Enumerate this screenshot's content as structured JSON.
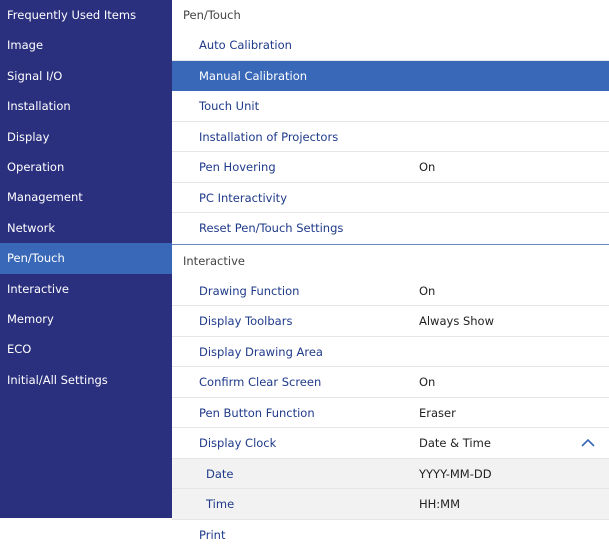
{
  "sidebar": {
    "items": [
      {
        "label": "Frequently Used Items"
      },
      {
        "label": "Image"
      },
      {
        "label": "Signal I/O"
      },
      {
        "label": "Installation"
      },
      {
        "label": "Display"
      },
      {
        "label": "Operation"
      },
      {
        "label": "Management"
      },
      {
        "label": "Network"
      },
      {
        "label": "Pen/Touch"
      },
      {
        "label": "Interactive"
      },
      {
        "label": "Memory"
      },
      {
        "label": "ECO"
      },
      {
        "label": "Initial/All Settings"
      }
    ],
    "active_index": 8
  },
  "pen_touch": {
    "header": "Pen/Touch",
    "rows": [
      {
        "label": "Auto Calibration",
        "value": ""
      },
      {
        "label": "Manual Calibration",
        "value": ""
      },
      {
        "label": "Touch Unit",
        "value": ""
      },
      {
        "label": "Installation of Projectors",
        "value": ""
      },
      {
        "label": "Pen Hovering",
        "value": "On"
      },
      {
        "label": "PC Interactivity",
        "value": ""
      },
      {
        "label": "Reset Pen/Touch Settings",
        "value": ""
      }
    ],
    "selected_index": 1
  },
  "interactive": {
    "header": "Interactive",
    "rows": [
      {
        "label": "Drawing Function",
        "value": "On"
      },
      {
        "label": "Display Toolbars",
        "value": "Always Show"
      },
      {
        "label": "Display Drawing Area",
        "value": ""
      },
      {
        "label": "Confirm Clear Screen",
        "value": "On"
      },
      {
        "label": "Pen Button Function",
        "value": "Eraser"
      },
      {
        "label": "Display Clock",
        "value": "Date & Time",
        "expanded": true
      },
      {
        "label": "Date",
        "value": "YYYY-MM-DD",
        "sub": true
      },
      {
        "label": "Time",
        "value": "HH:MM",
        "sub": true
      },
      {
        "label": "Print",
        "value": ""
      }
    ]
  },
  "icons": {
    "expand_indicator": "chevron-up-icon"
  },
  "colors": {
    "sidebar_bg": "#2a2f7e",
    "selected_bg": "#3868b7",
    "item_text": "#1f3a8a"
  }
}
